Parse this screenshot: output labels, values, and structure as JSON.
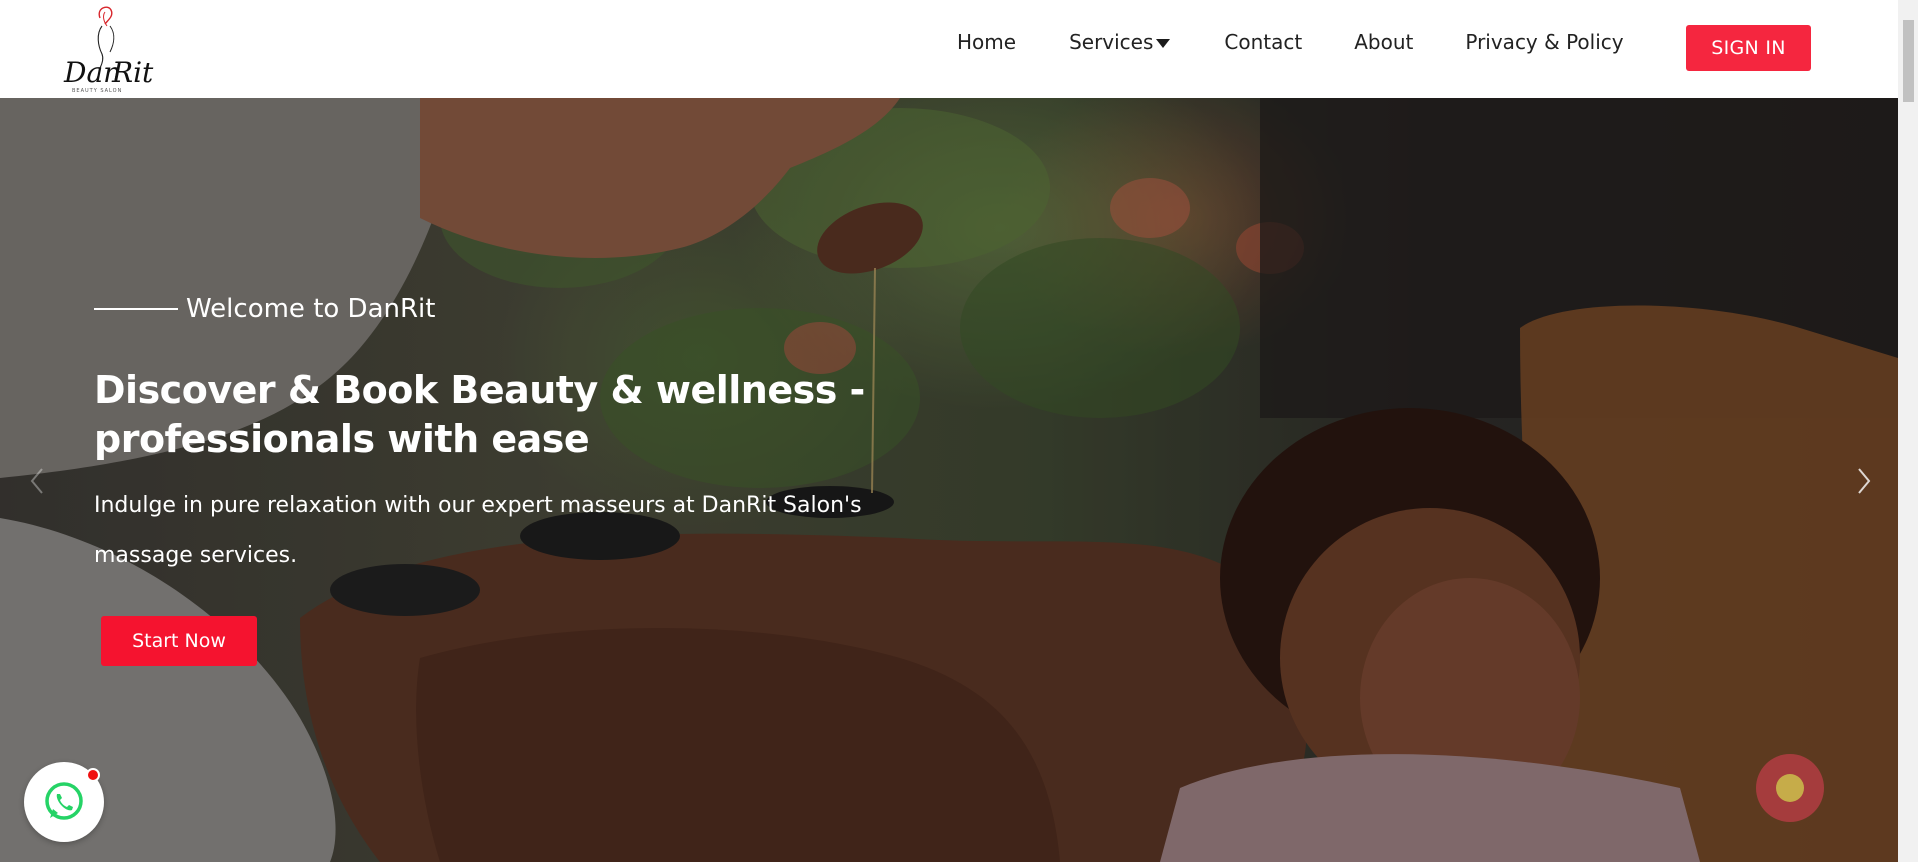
{
  "brand": {
    "logo_text": "DanRit",
    "logo_tagline": "BEAUTY SALON",
    "accent_color": "#f5263f"
  },
  "nav": {
    "items": [
      {
        "label": "Home"
      },
      {
        "label": "Services"
      },
      {
        "label": "Contact"
      },
      {
        "label": "About"
      },
      {
        "label": "Privacy & Policy"
      }
    ],
    "signin_label": "SIGN IN"
  },
  "hero": {
    "welcome": "Welcome to DanRit",
    "headline": "Discover & Book Beauty & wellness - professionals with ease",
    "subtext": "Indulge in pure relaxation with our expert masseurs at DanRit Salon's massage services.",
    "cta_label": "Start Now",
    "prev_icon": "chevron-left-icon",
    "next_icon": "chevron-right-icon"
  },
  "chat": {
    "icon": "whatsapp-icon",
    "has_notification": true,
    "notification_color": "#f01010"
  }
}
